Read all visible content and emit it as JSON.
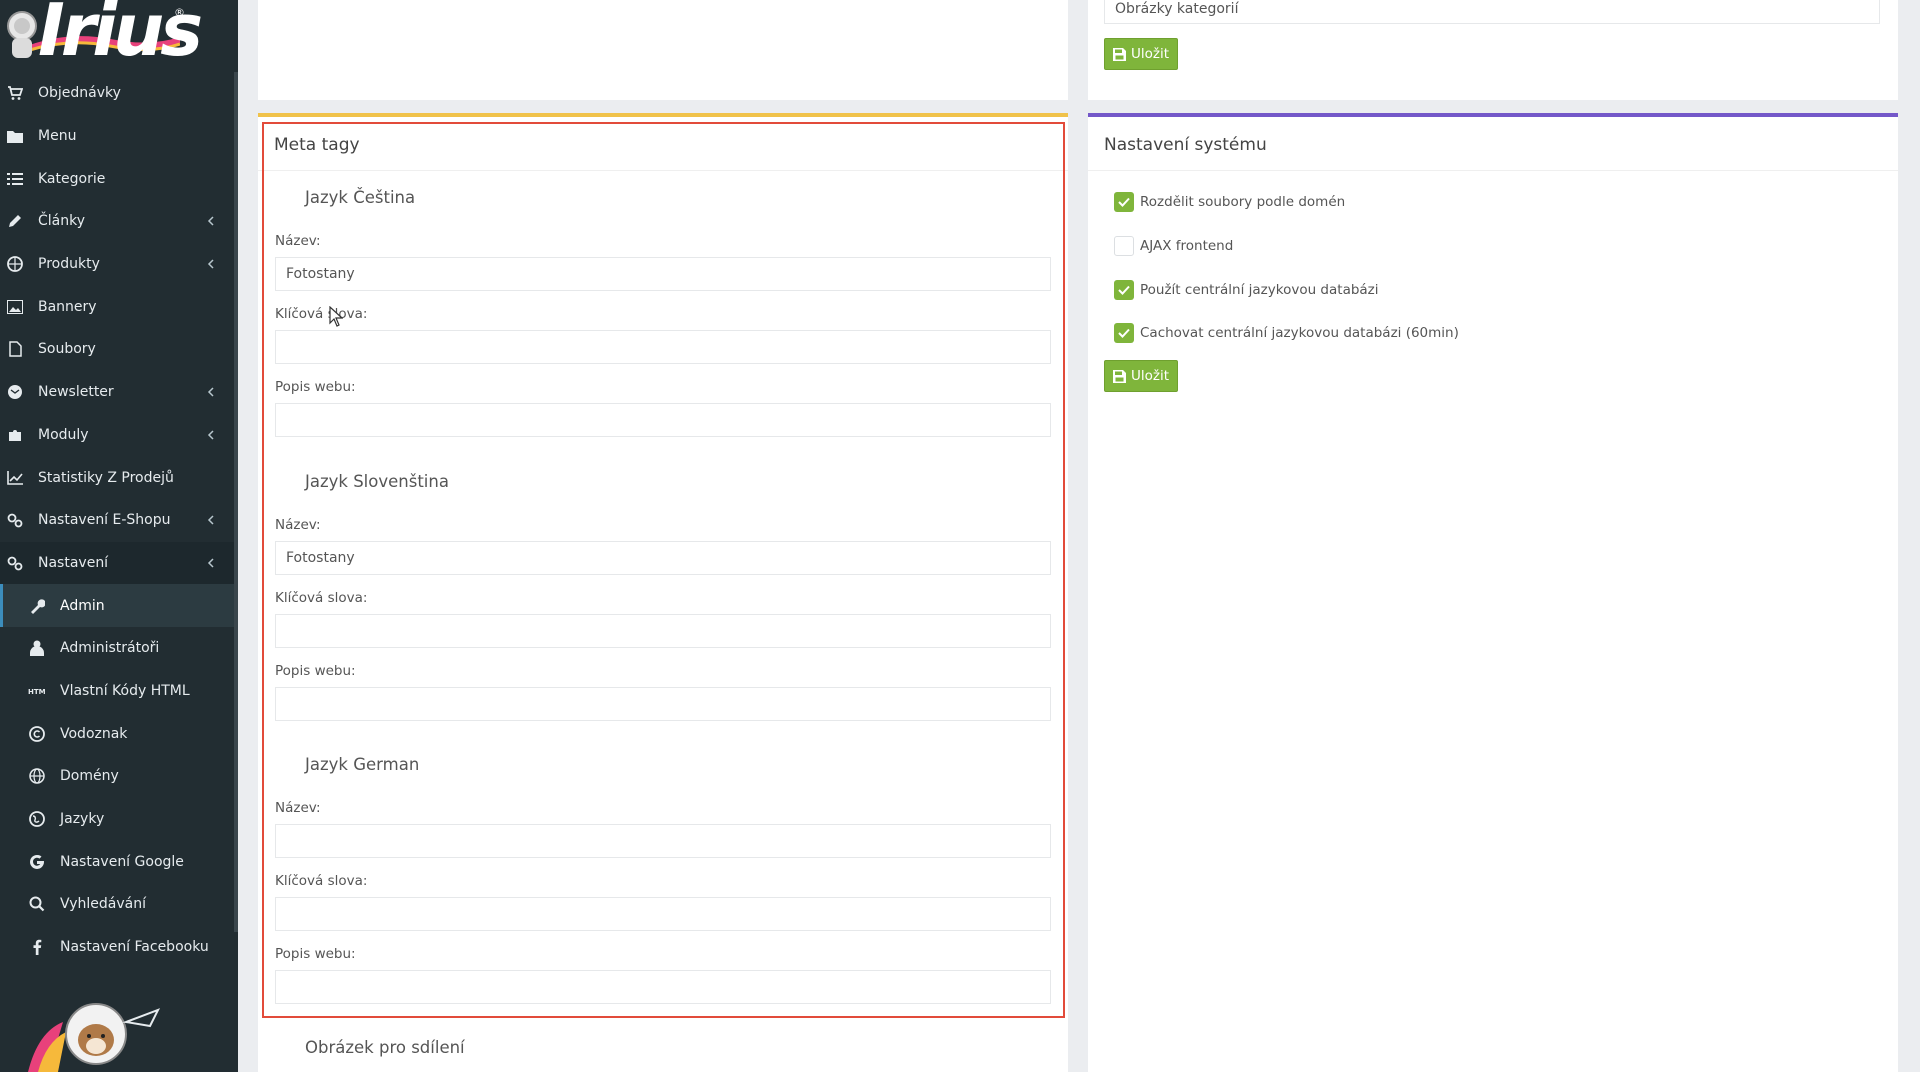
{
  "brand": {
    "logo_text": "Irius",
    "reg_mark": "®"
  },
  "sidebar": {
    "items": [
      {
        "label": "Objednávky",
        "icon": "cart-icon",
        "submenu": false
      },
      {
        "label": "Menu",
        "icon": "folder-icon",
        "submenu": false
      },
      {
        "label": "Kategorie",
        "icon": "list-icon",
        "submenu": false
      },
      {
        "label": "Články",
        "icon": "pencil-icon",
        "submenu": true
      },
      {
        "label": "Produkty",
        "icon": "cubes-icon",
        "submenu": true
      },
      {
        "label": "Bannery",
        "icon": "image-icon",
        "submenu": false
      },
      {
        "label": "Soubory",
        "icon": "file-icon",
        "submenu": false
      },
      {
        "label": "Newsletter",
        "icon": "envelope-icon",
        "submenu": true
      },
      {
        "label": "Moduly",
        "icon": "puzzle-icon",
        "submenu": true
      },
      {
        "label": "Statistiky Z Prodejů",
        "icon": "chart-icon",
        "submenu": false
      },
      {
        "label": "Nastavení E-Shopu",
        "icon": "cogs-icon",
        "submenu": true
      },
      {
        "label": "Nastavení",
        "icon": "cogs-icon",
        "submenu": true
      }
    ],
    "sub_items": [
      {
        "label": "Admin",
        "icon": "wrench-icon"
      },
      {
        "label": "Administrátoři",
        "icon": "user-icon"
      },
      {
        "label": "Vlastní Kódy HTML",
        "icon": "html-icon"
      },
      {
        "label": "Vodoznak",
        "icon": "copyright-icon"
      },
      {
        "label": "Domény",
        "icon": "globe-icon"
      },
      {
        "label": "Jazyky",
        "icon": "globe-alt-icon"
      },
      {
        "label": "Nastavení Google",
        "icon": "google-icon"
      },
      {
        "label": "Vyhledávání",
        "icon": "search-icon"
      },
      {
        "label": "Nastavení Facebooku",
        "icon": "facebook-icon"
      }
    ]
  },
  "top_right": {
    "field_value": "Obrázky kategorií",
    "save_label": "Uložit"
  },
  "meta": {
    "title": "Meta tagy",
    "languages": [
      {
        "heading": "Jazyk Čeština",
        "name_label": "Název:",
        "name_value": "Fotostany",
        "keywords_label": "Klíčová slova:",
        "keywords_value": "",
        "desc_label": "Popis webu:",
        "desc_value": ""
      },
      {
        "heading": "Jazyk Slovenština",
        "name_label": "Název:",
        "name_value": "Fotostany",
        "keywords_label": "Klíčová slova:",
        "keywords_value": "",
        "desc_label": "Popis webu:",
        "desc_value": ""
      },
      {
        "heading": "Jazyk German",
        "name_label": "Název:",
        "name_value": "",
        "keywords_label": "Klíčová slova:",
        "keywords_value": "",
        "desc_label": "Popis webu:",
        "desc_value": ""
      }
    ],
    "share_image_heading": "Obrázek pro sdílení"
  },
  "system": {
    "title": "Nastavení systému",
    "options": [
      {
        "label": "Rozdělit soubory podle domén",
        "checked": true
      },
      {
        "label": "AJAX frontend",
        "checked": false
      },
      {
        "label": "Použít centrální jazykovou databázi",
        "checked": true
      },
      {
        "label": "Cachovat centrální jazykovou databázi (60min)",
        "checked": true
      }
    ],
    "save_label": "Uložit"
  },
  "colors": {
    "sidebar_bg": "#222d32",
    "save_green": "#7fb53b",
    "meta_border": "#f0c24a",
    "system_border": "#7458c9",
    "highlight": "#e24b3a"
  }
}
